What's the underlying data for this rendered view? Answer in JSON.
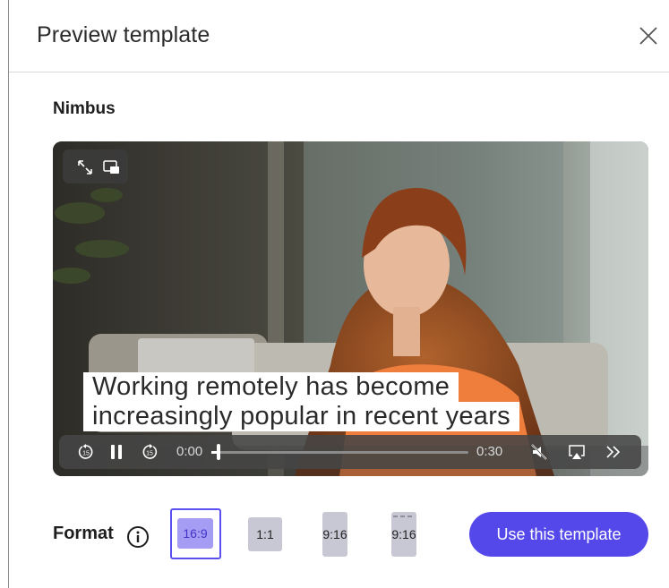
{
  "dialog": {
    "title": "Preview template",
    "template_name": "Nimbus"
  },
  "video": {
    "caption_line1": "Working remotely has become",
    "caption_line2": "increasingly popular in recent years",
    "current_time": "0:00",
    "duration": "0:30",
    "progress_fraction": 0.02,
    "rewind_seconds": "15",
    "forward_seconds": "15"
  },
  "format": {
    "label": "Format",
    "options": [
      {
        "label": "16:9",
        "selected": true
      },
      {
        "label": "1:1",
        "selected": false
      },
      {
        "label": "9:16",
        "selected": false
      },
      {
        "label": "9:16",
        "selected": false
      }
    ]
  },
  "actions": {
    "use_template_label": "Use this template"
  },
  "colors": {
    "accent": "#5448ea",
    "selected_border": "#5a4ff0",
    "chip": "#c8c8d4",
    "chip_selected": "#a59cf4"
  },
  "icons": {
    "close": "close-icon",
    "fullscreen": "expand-icon",
    "pip": "picture-in-picture-icon",
    "rewind": "rewind-15-icon",
    "pause": "pause-icon",
    "forward": "forward-15-icon",
    "mute": "mute-icon",
    "airplay": "airplay-icon",
    "more": "double-chevron-right-icon",
    "info": "info-icon"
  }
}
